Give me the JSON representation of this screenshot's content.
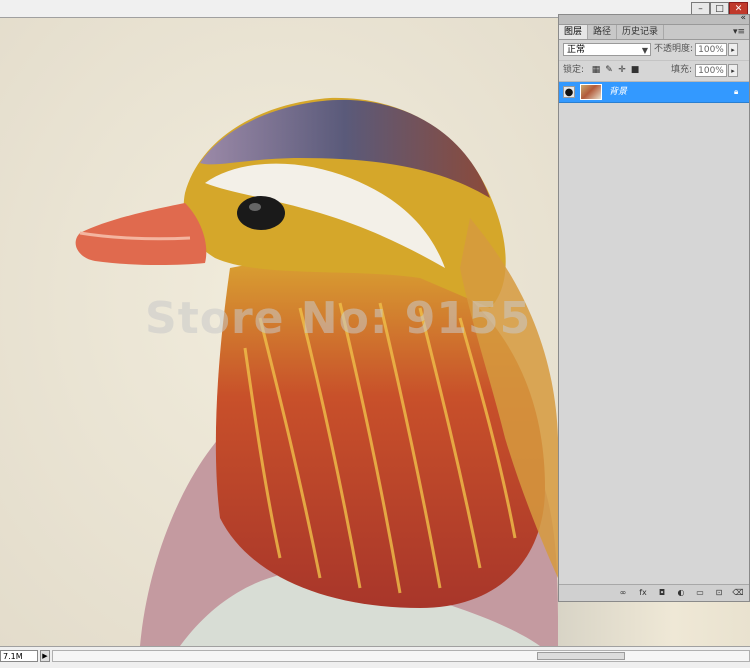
{
  "window": {
    "minimize_label": "–",
    "maximize_label": "□",
    "close_label": "✕"
  },
  "canvas": {
    "watermark": "Store No: 9155"
  },
  "panel": {
    "tabs": [
      {
        "label": "图层"
      },
      {
        "label": "路径"
      },
      {
        "label": "历史记录"
      }
    ],
    "blend_mode": "正常",
    "opacity_label": "不透明度:",
    "opacity_value": "100%",
    "lock_label": "锁定:",
    "fill_label": "填充:",
    "fill_value": "100%",
    "layers": [
      {
        "name": "背景",
        "selected": true
      }
    ]
  },
  "status": {
    "zoom": "7.1M"
  },
  "colors": {
    "selected_layer": "#3399ff",
    "close_button": "#c0392b"
  }
}
